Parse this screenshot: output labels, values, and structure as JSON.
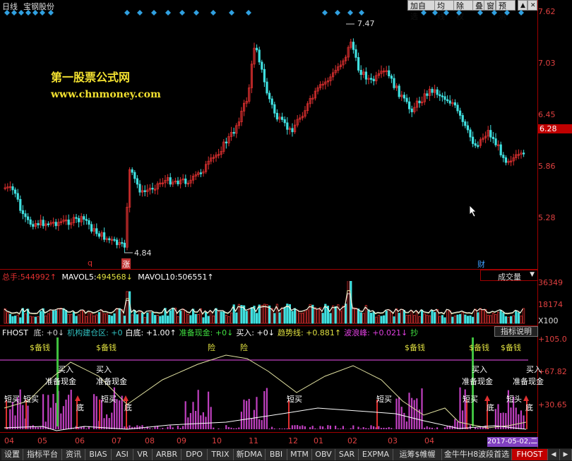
{
  "titlebar": {
    "period": "日线",
    "stock": "宝钢股份",
    "buttons": [
      "加自选",
      "均线",
      "除权",
      "叠",
      "窗",
      "预测"
    ],
    "scroll_up": "▲",
    "close": "✕"
  },
  "watermark": {
    "line1": "第一股票公式网",
    "line2": "www.chnmoney.com"
  },
  "price_axis": {
    "labels": [
      "7.62",
      "7.03",
      "6.45",
      "6.28",
      "5.86",
      "5.28"
    ],
    "current": "6.28"
  },
  "price_annotations": {
    "high": "7.47",
    "low": "4.84",
    "marker_q": "q",
    "marker_zhang": "涨",
    "marker_cai": "财"
  },
  "volume_panel": {
    "total_label": "总手:",
    "total_value": "544992↑",
    "mavol5_label": "MAVOL5:",
    "mavol5_value": "494568↓",
    "mavol10_label": "MAVOL10:",
    "mavol10_value": "506551↑",
    "selector": "成交量",
    "axis": [
      "36349",
      "18174",
      "X100"
    ]
  },
  "indicator_panel": {
    "name": "FHOST",
    "items": [
      {
        "label": "底:",
        "value": "+0↓",
        "color": "#d0d0d0"
      },
      {
        "label": "机构建仓区:",
        "value": "+0",
        "color": "#30c0c0"
      },
      {
        "label": "白底:",
        "value": "+1.00↑",
        "color": "#ffffff"
      },
      {
        "label": "准备现金:",
        "value": "+0↓",
        "color": "#40e040"
      },
      {
        "label": "买入:",
        "value": "+0↓",
        "color": "#ffffff"
      },
      {
        "label": "趋势线:",
        "value": "+0.881↑",
        "color": "#e0e040"
      },
      {
        "label": "波浪峰:",
        "value": "+0.021↓",
        "color": "#e040e0"
      },
      {
        "label": "抄",
        "value": "",
        "color": "#40e040"
      }
    ],
    "help_button": "指标说明",
    "axis": [
      "+105.0",
      "+67.82",
      "+30.65"
    ],
    "labels": {
      "beiqian": "$备钱",
      "xian": "险",
      "mairu": "买入",
      "zhunbei": "准备现金",
      "zhunbei_short": "准备现金",
      "duanmai": "短买",
      "di": "底",
      "duantou": "短头"
    }
  },
  "x_axis": [
    "04",
    "05",
    "06",
    "07",
    "08",
    "09",
    "10",
    "11",
    "12",
    "01",
    "02",
    "03",
    "04"
  ],
  "date_display": "2017-05-02,二",
  "tabs": [
    "设置",
    "指标平台",
    "资讯",
    "BIAS",
    "ASI",
    "VR",
    "ARBR",
    "DPO",
    "TRIX",
    "新DMA",
    "BBI",
    "MTM",
    "OBV",
    "SAR",
    "EXPMA",
    "运筹$帷幄",
    "金牛牛H8波段首选",
    "FHOST"
  ],
  "colors": {
    "up": "#e03030",
    "down": "#40e0e0",
    "axis": "#a00000",
    "purple": "#c040c0"
  }
}
